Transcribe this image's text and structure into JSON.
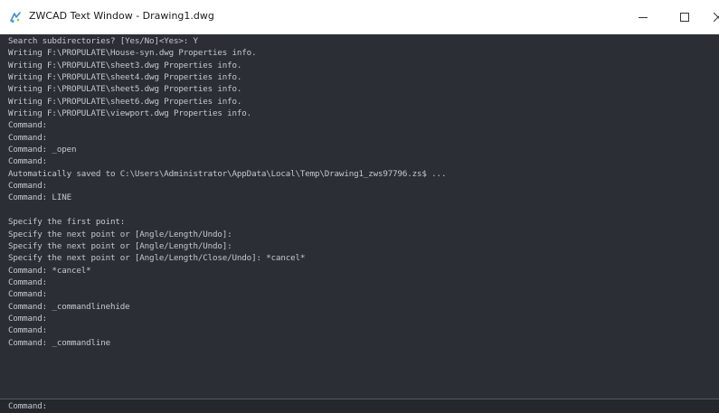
{
  "window": {
    "title": "ZWCAD Text Window - Drawing1.dwg",
    "icon": "zwcad-app-icon",
    "controls": {
      "minimize_icon": "minimize-icon",
      "maximize_icon": "maximize-icon",
      "close_icon": "close-icon"
    }
  },
  "colors": {
    "console_background": "#2b2f35",
    "console_text": "#c3c8cf",
    "titlebar_background": "#ffffff"
  },
  "history": {
    "lines": [
      "Search subdirectories? [Yes/No]<Yes>: Y",
      "Writing F:\\PROPULATE\\House-syn.dwg Properties info.",
      "Writing F:\\PROPULATE\\sheet3.dwg Properties info.",
      "Writing F:\\PROPULATE\\sheet4.dwg Properties info.",
      "Writing F:\\PROPULATE\\sheet5.dwg Properties info.",
      "Writing F:\\PROPULATE\\sheet6.dwg Properties info.",
      "Writing F:\\PROPULATE\\viewport.dwg Properties info.",
      "Command:",
      "Command:",
      "Command: _open",
      "Command:",
      "Automatically saved to C:\\Users\\Administrator\\AppData\\Local\\Temp\\Drawing1_zws97796.zs$ ...",
      "Command:",
      "Command: LINE",
      "",
      "Specify the first point:",
      "Specify the next point or [Angle/Length/Undo]:",
      "Specify the next point or [Angle/Length/Undo]:",
      "Specify the next point or [Angle/Length/Close/Undo]: *cancel*",
      "Command: *cancel*",
      "Command:",
      "Command:",
      "Command: _commandlinehide",
      "Command:",
      "Command:",
      "Command: _commandline"
    ]
  },
  "prompt": {
    "label": "Command:",
    "value": ""
  }
}
